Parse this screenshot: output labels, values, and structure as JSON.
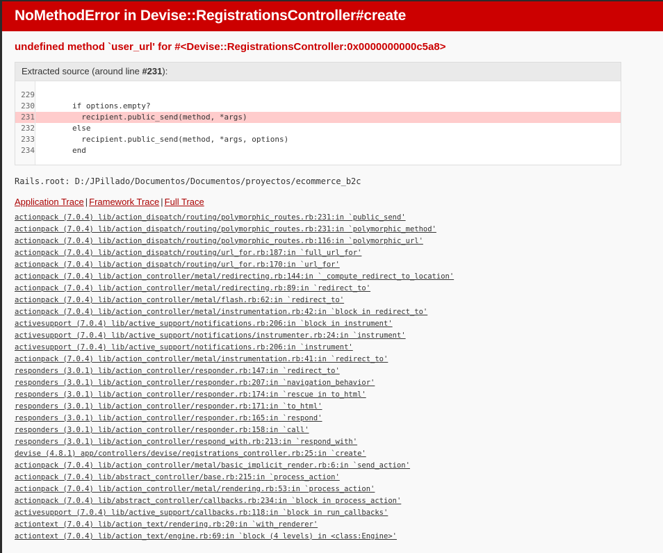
{
  "header": {
    "title": "NoMethodError in Devise::RegistrationsController#create",
    "band_color": "#cc0000"
  },
  "error_message": "undefined method `user_url' for #<Devise::RegistrationsController:0x0000000000c5a8>",
  "source": {
    "header_prefix": "Extracted source (around line ",
    "header_line": "#231",
    "header_suffix": "):",
    "highlight_color": "#ffcccc",
    "lines": [
      {
        "number": "229",
        "code": ""
      },
      {
        "number": "230",
        "code": "        if options.empty?"
      },
      {
        "number": "231",
        "code": "          recipient.public_send(method, *args)",
        "highlight": true
      },
      {
        "number": "232",
        "code": "        else"
      },
      {
        "number": "233",
        "code": "          recipient.public_send(method, *args, options)"
      },
      {
        "number": "234",
        "code": "        end"
      }
    ]
  },
  "rails_root": "Rails.root: D:/JPillado/Documentos/Documentos/proyectos/ecommerce_b2c",
  "trace_toggles": {
    "application": "Application Trace",
    "framework": "Framework Trace",
    "full": "Full Trace",
    "separator": "|"
  },
  "trace_lines": [
    "actionpack (7.0.4) lib/action_dispatch/routing/polymorphic_routes.rb:231:in `public_send'",
    "actionpack (7.0.4) lib/action_dispatch/routing/polymorphic_routes.rb:231:in `polymorphic_method'",
    "actionpack (7.0.4) lib/action_dispatch/routing/polymorphic_routes.rb:116:in `polymorphic_url'",
    "actionpack (7.0.4) lib/action_dispatch/routing/url_for.rb:187:in `full_url_for'",
    "actionpack (7.0.4) lib/action_dispatch/routing/url_for.rb:170:in `url_for'",
    "actionpack (7.0.4) lib/action_controller/metal/redirecting.rb:144:in `_compute_redirect_to_location'",
    "actionpack (7.0.4) lib/action_controller/metal/redirecting.rb:89:in `redirect_to'",
    "actionpack (7.0.4) lib/action_controller/metal/flash.rb:62:in `redirect_to'",
    "actionpack (7.0.4) lib/action_controller/metal/instrumentation.rb:42:in `block in redirect_to'",
    "activesupport (7.0.4) lib/active_support/notifications.rb:206:in `block in instrument'",
    "activesupport (7.0.4) lib/active_support/notifications/instrumenter.rb:24:in `instrument'",
    "activesupport (7.0.4) lib/active_support/notifications.rb:206:in `instrument'",
    "actionpack (7.0.4) lib/action_controller/metal/instrumentation.rb:41:in `redirect_to'",
    "responders (3.0.1) lib/action_controller/responder.rb:147:in `redirect_to'",
    "responders (3.0.1) lib/action_controller/responder.rb:207:in `navigation_behavior'",
    "responders (3.0.1) lib/action_controller/responder.rb:174:in `rescue in to_html'",
    "responders (3.0.1) lib/action_controller/responder.rb:171:in `to_html'",
    "responders (3.0.1) lib/action_controller/responder.rb:165:in `respond'",
    "responders (3.0.1) lib/action_controller/responder.rb:158:in `call'",
    "responders (3.0.1) lib/action_controller/respond_with.rb:213:in `respond_with'",
    "devise (4.8.1) app/controllers/devise/registrations_controller.rb:25:in `create'",
    "actionpack (7.0.4) lib/action_controller/metal/basic_implicit_render.rb:6:in `send_action'",
    "actionpack (7.0.4) lib/abstract_controller/base.rb:215:in `process_action'",
    "actionpack (7.0.4) lib/action_controller/metal/rendering.rb:53:in `process_action'",
    "actionpack (7.0.4) lib/abstract_controller/callbacks.rb:234:in `block in process_action'",
    "activesupport (7.0.4) lib/active_support/callbacks.rb:118:in `block in run_callbacks'",
    "actiontext (7.0.4) lib/action_text/rendering.rb:20:in `with_renderer'",
    "actiontext (7.0.4) lib/action_text/engine.rb:69:in `block (4 levels) in <class:Engine>'"
  ]
}
